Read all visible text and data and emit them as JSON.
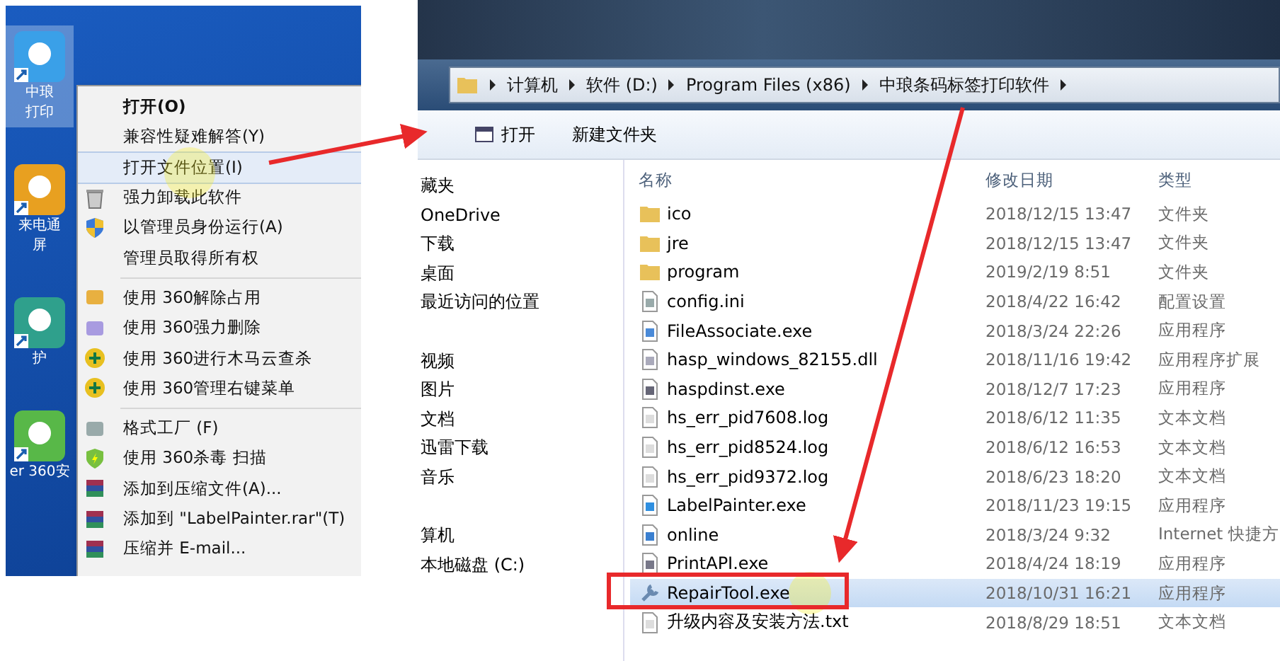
{
  "desktop": {
    "icons": [
      {
        "kind": "app",
        "lines": [
          "中琅",
          "打印"
        ],
        "selected": true
      },
      {
        "kind": "tv",
        "lines": [
          "来电通",
          "屏"
        ],
        "selected": false
      },
      {
        "kind": "eye",
        "lines": [
          "护"
        ],
        "selected": false
      },
      {
        "kind": "shield",
        "lines": [
          "er 360安"
        ],
        "selected": false
      }
    ]
  },
  "context_menu": {
    "groups": [
      [
        {
          "label": "打开(O)",
          "kind": "none",
          "bold": true,
          "selected": false
        },
        {
          "label": "兼容性疑难解答(Y)",
          "kind": "none",
          "bold": false,
          "selected": false
        },
        {
          "label": "打开文件位置(I)",
          "kind": "none",
          "bold": false,
          "selected": true
        },
        {
          "label": "强力卸载此软件",
          "kind": "trash",
          "bold": false,
          "selected": false
        },
        {
          "label": "以管理员身份运行(A)",
          "kind": "uac",
          "bold": false,
          "selected": false
        },
        {
          "label": "管理员取得所有权",
          "kind": "none",
          "bold": false,
          "selected": false
        }
      ],
      [
        {
          "label": "使用 360解除占用",
          "kind": "unlock",
          "bold": false,
          "selected": false
        },
        {
          "label": "使用 360强力删除",
          "kind": "shred",
          "bold": false,
          "selected": false
        },
        {
          "label": "使用 360进行木马云查杀",
          "kind": "plus",
          "bold": false,
          "selected": false
        },
        {
          "label": "使用 360管理右键菜单",
          "kind": "plus",
          "bold": false,
          "selected": false
        }
      ],
      [
        {
          "label": "格式工厂 (F)",
          "kind": "format",
          "bold": false,
          "selected": false
        },
        {
          "label": "使用 360杀毒 扫描",
          "kind": "antivirus",
          "bold": false,
          "selected": false
        },
        {
          "label": "添加到压缩文件(A)...",
          "kind": "archive",
          "bold": false,
          "selected": false
        },
        {
          "label": "添加到 \"LabelPainter.rar\"(T)",
          "kind": "archive",
          "bold": false,
          "selected": false
        },
        {
          "label": "压缩并 E-mail...",
          "kind": "archive",
          "bold": false,
          "selected": false
        }
      ]
    ]
  },
  "explorer": {
    "breadcrumb": [
      "计算机",
      "软件 (D:)",
      "Program Files (x86)",
      "中琅条码标签打印软件"
    ],
    "toolbar": [
      {
        "label": "打开",
        "kind": "open"
      },
      {
        "label": "新建文件夹",
        "kind": "none"
      }
    ],
    "nav": [
      [
        "藏夹",
        "OneDrive",
        "下载",
        "桌面",
        "最近访问的位置"
      ],
      [
        "视频",
        "图片",
        "文档",
        "迅雷下载",
        "音乐"
      ],
      [
        "算机",
        "本地磁盘 (C:)"
      ]
    ],
    "columns": [
      "名称",
      "修改日期",
      "类型"
    ],
    "rows": [
      {
        "name": "ico",
        "date": "2018/12/15 13:47",
        "type": "文件夹",
        "kind": "folder",
        "selected": false
      },
      {
        "name": "jre",
        "date": "2018/12/15 13:47",
        "type": "文件夹",
        "kind": "folder",
        "selected": false
      },
      {
        "name": "program",
        "date": "2019/2/19 8:51",
        "type": "文件夹",
        "kind": "folder",
        "selected": false
      },
      {
        "name": "config.ini",
        "date": "2018/4/22 16:42",
        "type": "配置设置",
        "kind": "config",
        "selected": false
      },
      {
        "name": "FileAssociate.exe",
        "date": "2018/3/24 22:26",
        "type": "应用程序",
        "kind": "link",
        "selected": false
      },
      {
        "name": "hasp_windows_82155.dll",
        "date": "2018/11/16 19:42",
        "type": "应用程序扩展",
        "kind": "dll",
        "selected": false
      },
      {
        "name": "haspdinst.exe",
        "date": "2018/12/7 17:23",
        "type": "应用程序",
        "kind": "window",
        "selected": false
      },
      {
        "name": "hs_err_pid7608.log",
        "date": "2018/6/12 11:35",
        "type": "文本文档",
        "kind": "text",
        "selected": false
      },
      {
        "name": "hs_err_pid8524.log",
        "date": "2018/6/12 16:53",
        "type": "文本文档",
        "kind": "text",
        "selected": false
      },
      {
        "name": "hs_err_pid9372.log",
        "date": "2018/6/23 18:20",
        "type": "文本文档",
        "kind": "text",
        "selected": false
      },
      {
        "name": "LabelPainter.exe",
        "date": "2018/11/23 19:15",
        "type": "应用程序",
        "kind": "app",
        "selected": false
      },
      {
        "name": "online",
        "date": "2018/3/24 9:32",
        "type": "Internet 快捷方",
        "kind": "web",
        "selected": false
      },
      {
        "name": "PrintAPI.exe",
        "date": "2018/4/24 18:19",
        "type": "应用程序",
        "kind": "printer",
        "selected": false
      },
      {
        "name": "RepairTool.exe",
        "date": "2018/10/31 16:21",
        "type": "应用程序",
        "kind": "wrench",
        "selected": true
      },
      {
        "name": "升级内容及安装方法.txt",
        "date": "2018/8/29 18:51",
        "type": "文本文档",
        "kind": "text",
        "selected": false
      }
    ]
  }
}
